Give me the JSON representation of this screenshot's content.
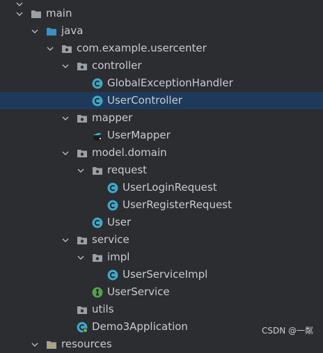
{
  "tree": {
    "items": [
      {
        "label": "main",
        "icon": "folder-icon",
        "expanded": true
      },
      {
        "label": "java",
        "icon": "source-folder-icon",
        "expanded": true
      },
      {
        "label": "com.example.usercenter",
        "icon": "package-icon",
        "expanded": true
      },
      {
        "label": "controller",
        "icon": "package-icon",
        "expanded": true
      },
      {
        "label": "GlobalExceptionHandler",
        "icon": "class-icon"
      },
      {
        "label": "UserController",
        "icon": "class-icon",
        "selected": true
      },
      {
        "label": "mapper",
        "icon": "package-icon",
        "expanded": true
      },
      {
        "label": "UserMapper",
        "icon": "mybatis-mapper-icon"
      },
      {
        "label": "model.domain",
        "icon": "package-icon",
        "expanded": true
      },
      {
        "label": "request",
        "icon": "package-icon",
        "expanded": true
      },
      {
        "label": "UserLoginRequest",
        "icon": "class-icon"
      },
      {
        "label": "UserRegisterRequest",
        "icon": "class-icon"
      },
      {
        "label": "User",
        "icon": "class-icon"
      },
      {
        "label": "service",
        "icon": "package-icon",
        "expanded": true
      },
      {
        "label": "impl",
        "icon": "package-icon",
        "expanded": true
      },
      {
        "label": "UserServiceImpl",
        "icon": "class-icon"
      },
      {
        "label": "UserService",
        "icon": "interface-icon"
      },
      {
        "label": "utils",
        "icon": "package-icon",
        "expanded": false
      },
      {
        "label": "Demo3Application",
        "icon": "spring-boot-class-icon"
      },
      {
        "label": "resources",
        "icon": "resources-folder-icon",
        "expanded": true
      }
    ]
  },
  "watermark": "CSDN @一粼",
  "colors": {
    "background": "#2b2d30",
    "selection": "#1e3a5a",
    "class_icon": "#3fa7c7",
    "interface_icon": "#56a04b",
    "folder_icon": "#9aa0a6",
    "source_folder_icon": "#3d8fc4"
  }
}
